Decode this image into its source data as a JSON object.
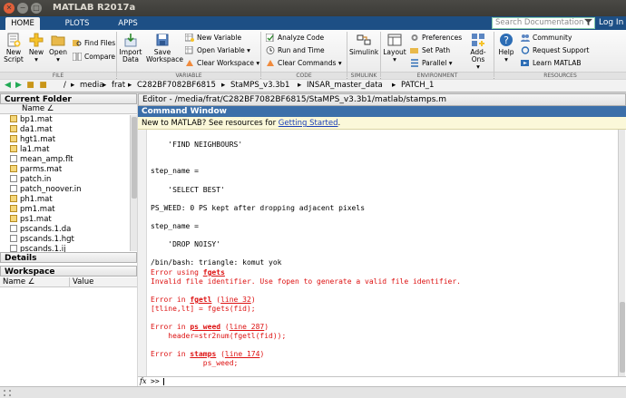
{
  "window": {
    "title": "MATLAB R2017a"
  },
  "tabs": [
    "HOME",
    "PLOTS",
    "APPS"
  ],
  "search": {
    "placeholder": "Search Documentation"
  },
  "login_label": "Log In",
  "ribbon": {
    "file": {
      "new_script": [
        "New",
        "Script"
      ],
      "new": "New",
      "open": "Open",
      "find_files": "Find Files",
      "compare": "Compare",
      "section": "FILE"
    },
    "variable": {
      "import_data": [
        "Import",
        "Data"
      ],
      "save_workspace": [
        "Save",
        "Workspace"
      ],
      "new_variable": "New Variable",
      "open_variable": "Open Variable",
      "clear_workspace": "Clear Workspace",
      "section": "VARIABLE"
    },
    "code": {
      "analyze_code": "Analyze Code",
      "run_and_time": "Run and Time",
      "clear_commands": "Clear Commands",
      "section": "CODE"
    },
    "simulink": {
      "simulink": "Simulink",
      "section": "SIMULINK"
    },
    "environment": {
      "layout": "Layout",
      "preferences": "Preferences",
      "set_path": "Set Path",
      "parallel": "Parallel",
      "add_ons": "Add-Ons",
      "section": "ENVIRONMENT"
    },
    "resources": {
      "help": "Help",
      "community": "Community",
      "request_support": "Request Support",
      "learn_matlab": "Learn MATLAB",
      "section": "RESOURCES"
    }
  },
  "path": {
    "root": "/",
    "segments": [
      "media",
      "frat",
      "C282BF7082BF6815",
      "StaMPS_v3.3b1",
      "INSAR_master_data",
      "PATCH_1"
    ]
  },
  "current_folder": {
    "title": "Current Folder",
    "column": "Name ∠",
    "files": [
      "bp1.mat",
      "da1.mat",
      "hgt1.mat",
      "la1.mat",
      "mean_amp.flt",
      "parms.mat",
      "patch.in",
      "patch_noover.in",
      "ph1.mat",
      "pm1.mat",
      "ps1.mat",
      "pscands.1.da",
      "pscands.1.hgt",
      "pscands.1.ij"
    ]
  },
  "details": {
    "title": "Details"
  },
  "workspace": {
    "title": "Workspace",
    "col_name": "Name ∠",
    "col_value": "Value"
  },
  "editor": {
    "title": "Editor - /media/frat/C282BF7082BF6815/StaMPS_v3.3b1/matlab/stamps.m"
  },
  "command_window": {
    "title": "Command Window",
    "notice_prefix": "New to MATLAB? See resources for ",
    "notice_link": "Getting Started",
    "notice_suffix": ".",
    "lines": {
      "l1": "    'FIND NEIGHBOURS'",
      "l2": "step_name =",
      "l3": "    'SELECT BEST'",
      "l4": "PS_WEED: 0 PS kept after dropping adjacent pixels",
      "l5": "step_name =",
      "l6": "    'DROP NOISY'",
      "l7": "/bin/bash: triangle: komut yok",
      "l8a": "Error using ",
      "l8b": "fgets",
      "l9": "Invalid file identifier. Use fopen to generate a valid file identifier.",
      "l10a": "Error in ",
      "l10b": "fgetl",
      "l10c": " (",
      "l10d": "line 32",
      "l10e": ")",
      "l11": "[tline,lt] = fgets(fid);",
      "l12a": "Error in ",
      "l12b": "ps_weed",
      "l12c": " (",
      "l12d": "line 287",
      "l12e": ")",
      "l13": "    header=str2num(fgetl(fid));",
      "l14a": "Error in ",
      "l14b": "stamps",
      "l14c": " (",
      "l14d": "line 174",
      "l14e": ")",
      "l15": "            ps_weed;"
    },
    "prompt": ">>",
    "fx": "fx"
  }
}
